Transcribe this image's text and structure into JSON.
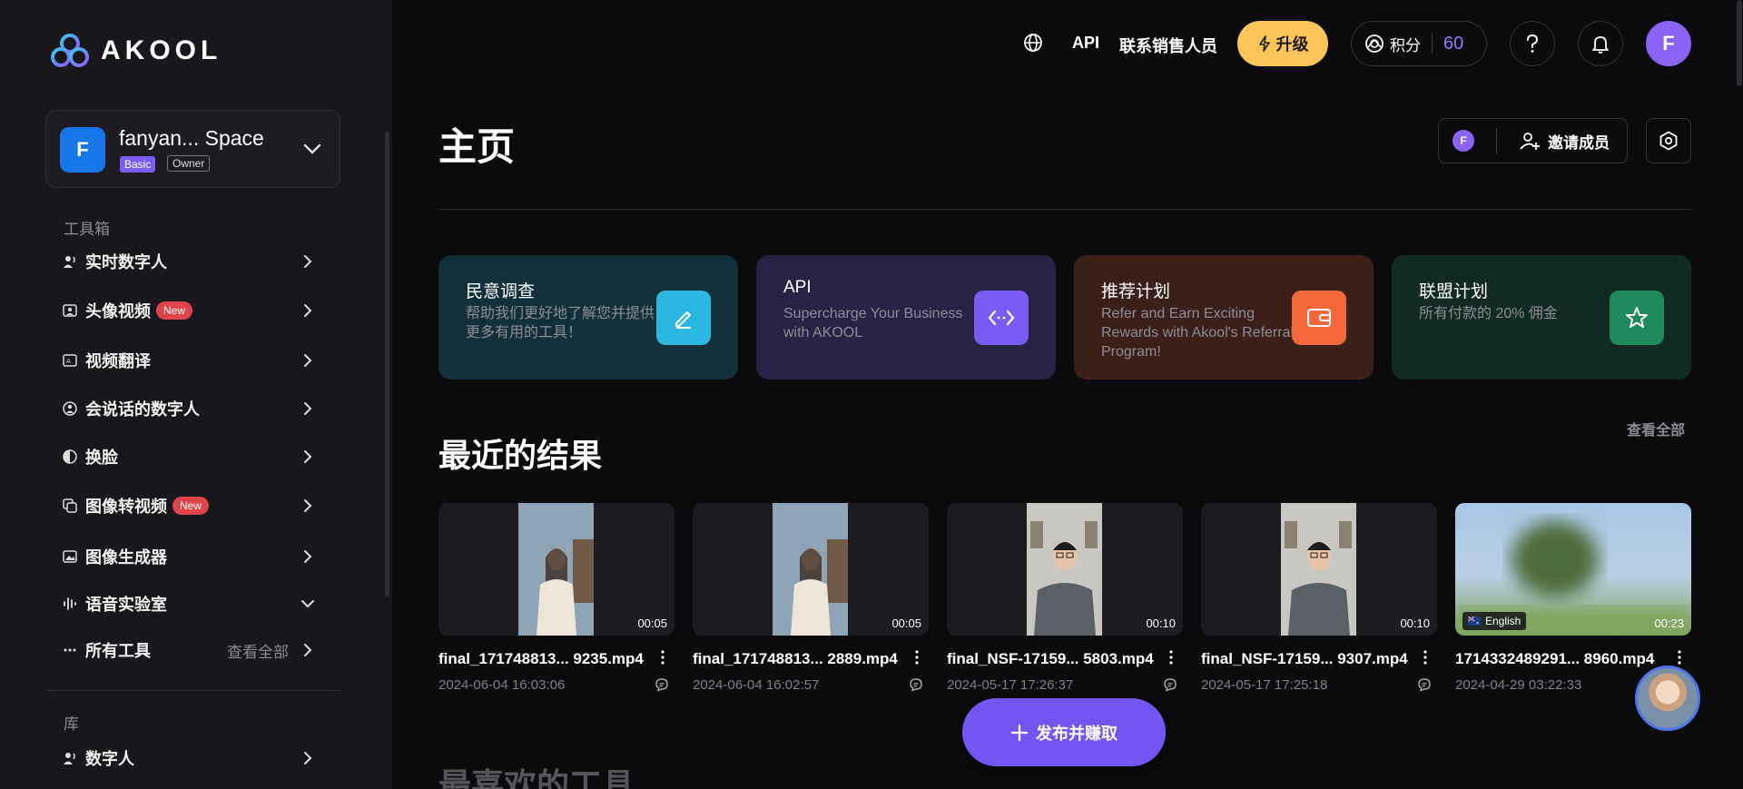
{
  "brand": {
    "name": "AKOOL"
  },
  "space": {
    "avatar_letter": "F",
    "name": "fanyan... Space",
    "plan": "Basic",
    "role": "Owner"
  },
  "sidebar": {
    "toolbox_label": "工具箱",
    "items": [
      {
        "label": "实时数字人",
        "icon": "realtime-avatar-icon",
        "new": false
      },
      {
        "label": "头像视频",
        "icon": "avatar-video-icon",
        "new": true
      },
      {
        "label": "视频翻译",
        "icon": "video-translate-icon",
        "new": false
      },
      {
        "label": "会说话的数字人",
        "icon": "talking-avatar-icon",
        "new": false
      },
      {
        "label": "换脸",
        "icon": "face-swap-icon",
        "new": false
      },
      {
        "label": "图像转视频",
        "icon": "image-to-video-icon",
        "new": true
      },
      {
        "label": "图像生成器",
        "icon": "image-generator-icon",
        "new": false
      },
      {
        "label": "语音实验室",
        "icon": "voice-lab-icon",
        "new": false
      }
    ],
    "new_label": "New",
    "all_tools_label": "所有工具",
    "all_tools_more": "查看全部",
    "library_label": "库",
    "library_items": [
      {
        "label": "数字人",
        "icon": "avatar-icon"
      }
    ]
  },
  "topbar": {
    "api_label": "API",
    "contact_sales_label": "联系销售人员",
    "upgrade_label": "升级",
    "credits_label": "积分",
    "credits_value": "60",
    "user_letter": "F"
  },
  "header": {
    "title": "主页",
    "member_letter": "F",
    "invite_label": "邀请成员"
  },
  "promos": [
    {
      "title": "民意调查",
      "desc": "帮助我们更好地了解您并提供更多有用的工具！",
      "bg": "#11303a",
      "icon_bg": "#2bb8e0",
      "icon": "pen-icon"
    },
    {
      "title": "API",
      "desc": "Supercharge Your Business with AKOOL",
      "bg": "#262344",
      "icon_bg": "#7a5cf5",
      "icon": "code-icon"
    },
    {
      "title": "推荐计划",
      "desc": "Refer and Earn Exciting Rewards with Akool's Referral Program!",
      "bg": "#3a2018",
      "icon_bg": "#f2683a",
      "icon": "wallet-icon"
    },
    {
      "title": "联盟计划",
      "desc": "所有付款的 20% 佣金",
      "bg": "#112a22",
      "icon_bg": "#1f8a5a",
      "icon": "star-icon"
    }
  ],
  "recent": {
    "title": "最近的结果",
    "see_all": "查看全部",
    "items": [
      {
        "name": "final_171748813... 9235.mp4",
        "date": "2024-06-04 16:03:06",
        "duration": "00:05",
        "thumb": "woman"
      },
      {
        "name": "final_171748813... 2889.mp4",
        "date": "2024-06-04 16:02:57",
        "duration": "00:05",
        "thumb": "woman"
      },
      {
        "name": "final_NSF-17159... 5803.mp4",
        "date": "2024-05-17 17:26:37",
        "duration": "00:10",
        "thumb": "man"
      },
      {
        "name": "final_NSF-17159... 9307.mp4",
        "date": "2024-05-17 17:25:18",
        "duration": "00:10",
        "thumb": "man"
      },
      {
        "name": "1714332489291... 8960.mp4",
        "date": "2024-04-29 03:22:33",
        "duration": "00:23",
        "thumb": "landscape",
        "lang": "English"
      }
    ]
  },
  "favorites": {
    "title": "最喜欢的工具"
  },
  "publish": {
    "label": "发布并赚取"
  }
}
